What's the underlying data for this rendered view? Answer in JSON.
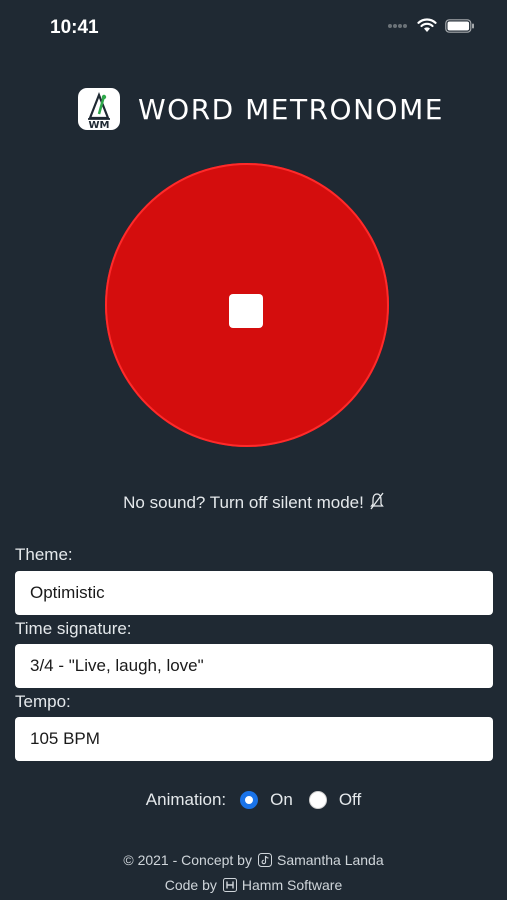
{
  "status_bar": {
    "time": "10:41"
  },
  "header": {
    "title": "WORD METRONOME",
    "logo_text": "WM"
  },
  "player": {
    "state_icon": "stop-icon",
    "accent_color": "#d40d0d"
  },
  "hint": {
    "text": "No sound? Turn off silent mode!"
  },
  "form": {
    "theme_label": "Theme:",
    "theme_value": "Optimistic",
    "time_signature_label": "Time signature:",
    "time_signature_value": "3/4 - \"Live, laugh, love\"",
    "tempo_label": "Tempo:",
    "tempo_value": "105 BPM"
  },
  "animation": {
    "label": "Animation:",
    "on_label": "On",
    "off_label": "Off",
    "selected": "On"
  },
  "footer": {
    "concept_prefix": "© 2021 - Concept by",
    "concept_author": "Samantha Landa",
    "code_prefix": "Code by",
    "code_author": "Hamm Software"
  }
}
